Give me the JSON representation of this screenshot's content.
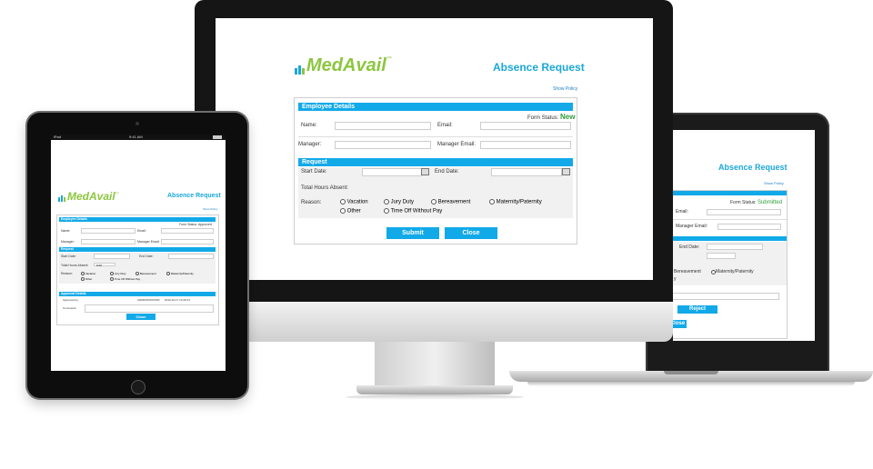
{
  "imac": {
    "logo_text": "MedAvail",
    "logo_tm": "™",
    "title": "Absence Request",
    "show_policy": "Show Policy",
    "employee_section": "Employee Details",
    "form_status_label": "Form Status:",
    "form_status_value": "New",
    "name_label": "Name:",
    "email_label": "Email:",
    "manager_label": "Manager:",
    "manager_email_label": "Manager Email:",
    "request_section": "Request",
    "start_date_label": "Start Date:",
    "end_date_label": "End Date:",
    "total_hours_label": "Total Hours Absent:",
    "reason_label": "Reason:",
    "reasons": [
      "Vacation",
      "Jury Duty",
      "Bereavement",
      "Maternity/Paternity",
      "Other",
      "Time Off Without Pay"
    ],
    "submit_label": "Submit",
    "close_label": "Close"
  },
  "laptop": {
    "title": "Absence Request",
    "show_policy": "Show Policy",
    "form_status_label": "Form Status:",
    "form_status_value": "Submitted",
    "email_label": "Email:",
    "manager_email_label": "Manager Email:",
    "end_date_label": "End Date:",
    "bereavement_label": "Bereavement",
    "maternity_label": "Maternity/Paternity",
    "reason_fragment": "y",
    "reject_label": "Reject",
    "close_label": "Close"
  },
  "ipad": {
    "status_left": "iPad",
    "status_center": "9:41 AM",
    "logo_text": "MedAvail",
    "logo_tm": "™",
    "title": "Absence Request",
    "show_policy": "Show Policy",
    "employee_section": "Employee Details",
    "form_status_label": "Form Status:",
    "form_status_value": "Approved",
    "name_label": "Name:",
    "email_label": "Email:",
    "manager_label": "Manager:",
    "manager_email_label": "Manager Email:",
    "request_section": "Request",
    "start_date_label": "Start Date:",
    "end_date_label": "End Date:",
    "total_hours_label": "Total Hours Absent:",
    "total_hours_value": "9.00",
    "reason_label": "Reason:",
    "reasons": [
      "Vacation",
      "Jury Duty",
      "Bereavement",
      "Maternity/Paternity",
      "Other",
      "Time Off Without Pay"
    ],
    "approval_section": "Approval Details",
    "approved_by_label": "Approved by:",
    "approved_by_value": "ADMINISTRATOR",
    "approved_date_value": "2016-10-17 14:29:13",
    "comments_label": "Comments:",
    "close_label": "Close"
  },
  "colors": {
    "accent": "#12a9e8",
    "brand_green": "#8cc63f",
    "status_green": "#2e9e3a"
  }
}
